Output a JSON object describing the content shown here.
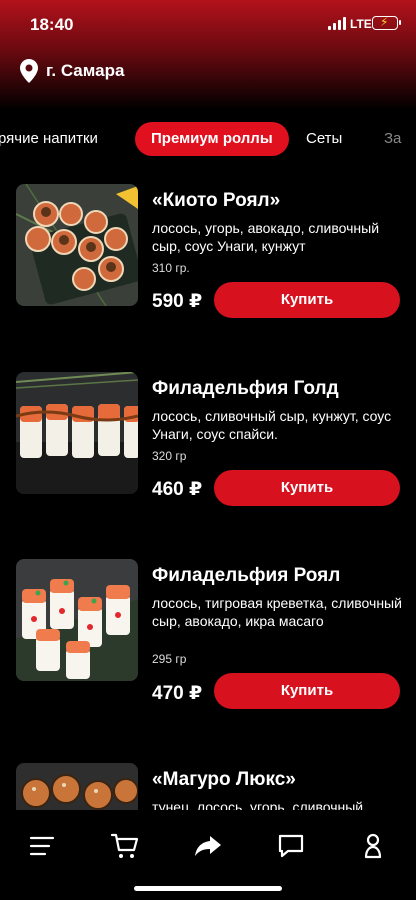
{
  "status": {
    "time": "18:40",
    "network": "LTE"
  },
  "location": {
    "city": "г. Самара"
  },
  "tabs": [
    {
      "label": "рячие напитки",
      "active": false
    },
    {
      "label": "Премиум роллы",
      "active": true
    },
    {
      "label": "Сеты",
      "active": false
    },
    {
      "label": "За",
      "active": false
    }
  ],
  "products": [
    {
      "name": "«Киото Роял»",
      "description": "лосось, угорь, авокадо, сливочный сыр, соус Унаги, кунжут",
      "weight": "310 гр.",
      "price": "590 ₽",
      "buy_label": "Купить"
    },
    {
      "name": "Филадельфия Голд",
      "description": "лосось, сливочный сыр, кунжут, соус Унаги, соус спайси.",
      "weight": "320 гр",
      "price": "460 ₽",
      "buy_label": "Купить"
    },
    {
      "name": "Филадельфия Роял",
      "description": "лосось, тигровая креветка, сливочный сыр, авокадо, икра масаго",
      "weight": "295 гр",
      "price": "470 ₽",
      "buy_label": "Купить"
    },
    {
      "name": "«Магуро Люкс»",
      "description": "тунец, лосось, угорь, сливочный",
      "weight": "",
      "price": "",
      "buy_label": ""
    }
  ],
  "nav": [
    "menu-icon",
    "cart-icon",
    "share-icon",
    "chat-icon",
    "profile-icon"
  ],
  "colors": {
    "accent": "#d7111e",
    "background": "#000000"
  }
}
